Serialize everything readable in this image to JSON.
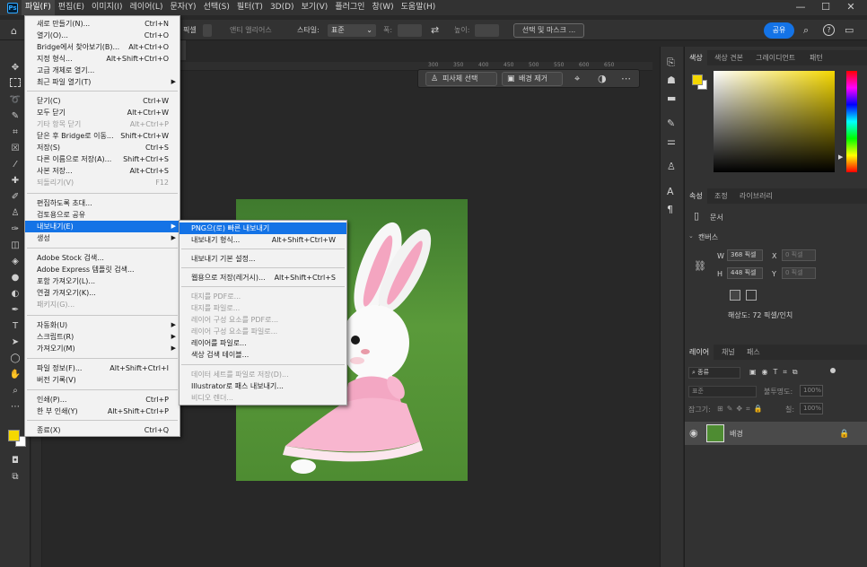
{
  "menubar": {
    "items": [
      "파일(F)",
      "편집(E)",
      "이미지(I)",
      "레이어(L)",
      "문자(Y)",
      "선택(S)",
      "필터(T)",
      "3D(D)",
      "보기(V)",
      "플러그인",
      "창(W)",
      "도움말(H)"
    ]
  },
  "window_controls": {
    "minimize": "—",
    "maximize": "☐",
    "close": "✕"
  },
  "options_bar": {
    "frag_feather": "픽셀",
    "anti_alias": "앤티 앨리어스",
    "style_label": "스타일:",
    "style_value": "표준",
    "width_label": "폭:",
    "height_label": "높이:",
    "select_mask": "선택 및 마스크 ...",
    "share": "공유"
  },
  "ruler": {
    "ticks": [
      "300",
      "350",
      "400",
      "450",
      "500",
      "550",
      "600",
      "650"
    ]
  },
  "context_bar": {
    "select_subject": "피사체 선택",
    "remove_bg": "배경 제거"
  },
  "file_menu": {
    "items": [
      {
        "label": "새로 만들기(N)...",
        "shortcut": "Ctrl+N"
      },
      {
        "label": "열기(O)...",
        "shortcut": "Ctrl+O"
      },
      {
        "label": "Bridge에서 찾아보기(B)...",
        "shortcut": "Alt+Ctrl+O"
      },
      {
        "label": "지정 형식...",
        "shortcut": "Alt+Shift+Ctrl+O"
      },
      {
        "label": "고급 개체로 열기...",
        "shortcut": ""
      },
      {
        "label": "최근 파일 열기(T)",
        "shortcut": ""
      },
      {
        "label": "닫기(C)",
        "shortcut": "Ctrl+W"
      },
      {
        "label": "모두 닫기",
        "shortcut": "Alt+Ctrl+W"
      },
      {
        "label": "기타 항목 닫기",
        "shortcut": "Alt+Ctrl+P"
      },
      {
        "label": "닫은 후 Bridge로 이동...",
        "shortcut": "Shift+Ctrl+W"
      },
      {
        "label": "저장(S)",
        "shortcut": "Ctrl+S"
      },
      {
        "label": "다른 이름으로 저장(A)...",
        "shortcut": "Shift+Ctrl+S"
      },
      {
        "label": "사본 저장...",
        "shortcut": "Alt+Ctrl+S"
      },
      {
        "label": "되돌리기(V)",
        "shortcut": "F12"
      },
      {
        "label": "편집하도록 초대...",
        "shortcut": ""
      },
      {
        "label": "검토용으로 공유",
        "shortcut": ""
      },
      {
        "label": "내보내기(E)",
        "shortcut": ""
      },
      {
        "label": "생성",
        "shortcut": ""
      },
      {
        "label": "Adobe Stock 검색...",
        "shortcut": ""
      },
      {
        "label": "Adobe Express 템플릿 검색...",
        "shortcut": ""
      },
      {
        "label": "포함 가져오기(L)...",
        "shortcut": ""
      },
      {
        "label": "연결 가져오기(K)...",
        "shortcut": ""
      },
      {
        "label": "패키지(G)...",
        "shortcut": ""
      },
      {
        "label": "자동화(U)",
        "shortcut": ""
      },
      {
        "label": "스크립트(R)",
        "shortcut": ""
      },
      {
        "label": "가져오기(M)",
        "shortcut": ""
      },
      {
        "label": "파일 정보(F)...",
        "shortcut": "Alt+Shift+Ctrl+I"
      },
      {
        "label": "버전 기록(V)",
        "shortcut": ""
      },
      {
        "label": "인쇄(P)...",
        "shortcut": "Ctrl+P"
      },
      {
        "label": "한 부 인쇄(Y)",
        "shortcut": "Alt+Shift+Ctrl+P"
      },
      {
        "label": "종료(X)",
        "shortcut": "Ctrl+Q"
      }
    ]
  },
  "export_menu": {
    "items": [
      {
        "label": "PNG으(로) 빠른 내보내기",
        "shortcut": ""
      },
      {
        "label": "내보내기 형식...",
        "shortcut": "Alt+Shift+Ctrl+W"
      },
      {
        "label": "내보내기 기본 설정...",
        "shortcut": ""
      },
      {
        "label": "웹용으로 저장(레거시)...",
        "shortcut": "Alt+Shift+Ctrl+S"
      },
      {
        "label": "대지를 PDF로...",
        "shortcut": ""
      },
      {
        "label": "대지를 파일로...",
        "shortcut": ""
      },
      {
        "label": "레이어 구성 요소를 PDF로...",
        "shortcut": ""
      },
      {
        "label": "레이어 구성 요소를 파일로...",
        "shortcut": ""
      },
      {
        "label": "레이어를 파일로...",
        "shortcut": ""
      },
      {
        "label": "색상 검색 테이블...",
        "shortcut": ""
      },
      {
        "label": "데이터 세트를 파일로 저장(D)...",
        "shortcut": ""
      },
      {
        "label": "Illustrator로 패스 내보내기...",
        "shortcut": ""
      },
      {
        "label": "비디오 렌더...",
        "shortcut": ""
      }
    ]
  },
  "color_panel": {
    "tabs": [
      "색상",
      "색상 견본",
      "그레이디언트",
      "패턴"
    ],
    "foreground": "#f5d800",
    "background": "#ffffff"
  },
  "props_panel": {
    "tabs": [
      "속성",
      "조정",
      "라이브러리"
    ],
    "doc_label": "문서",
    "canvas_label": "캔버스",
    "w_label": "W",
    "w_value": "368 픽셀",
    "h_label": "H",
    "h_value": "448 픽셀",
    "x_label": "X",
    "x_value": "0 픽셀",
    "y_label": "Y",
    "y_value": "0 픽셀",
    "resolution": "해상도: 72 픽셀/인치"
  },
  "layers_panel": {
    "tabs": [
      "레이어",
      "채널",
      "패스"
    ],
    "kind_label": "종류",
    "blend_mode": "표준",
    "opacity_label": "불투명도:",
    "opacity_value": "100%",
    "lock_label": "잠그기:",
    "fill_label": "칠:",
    "fill_value": "100%",
    "layer_name": "배경"
  },
  "colors": {
    "accent": "#1473e6",
    "highlight": "#1473e6"
  }
}
